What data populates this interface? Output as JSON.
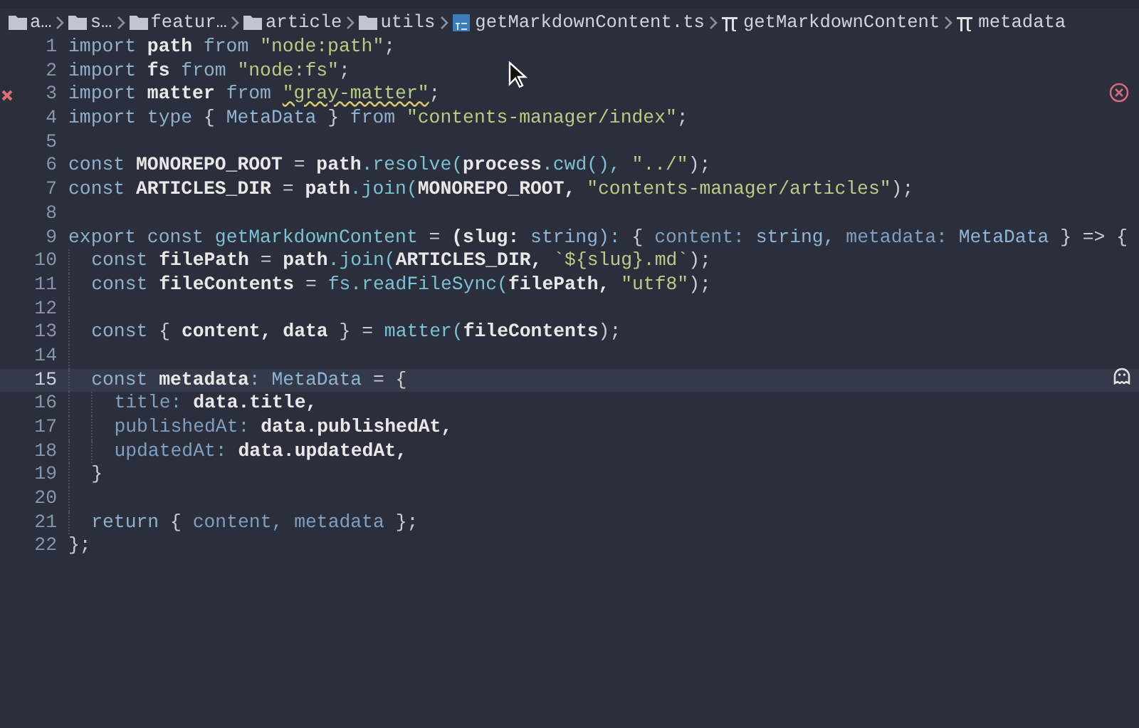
{
  "breadcrumb": [
    {
      "kind": "folder",
      "label": "a…"
    },
    {
      "kind": "folder",
      "label": "s…"
    },
    {
      "kind": "folder",
      "label": "featur…"
    },
    {
      "kind": "folder",
      "label": "article"
    },
    {
      "kind": "folder",
      "label": "utils"
    },
    {
      "kind": "file",
      "label": "getMarkdownContent.ts"
    },
    {
      "kind": "symbol",
      "label": "getMarkdownContent"
    },
    {
      "kind": "symbol",
      "label": "metadata"
    }
  ],
  "editor": {
    "lines": [
      {
        "number": "1",
        "error": false,
        "current": false,
        "tokens": [
          {
            "kind": "kw",
            "text": "import"
          },
          {
            "kind": "id",
            "text": "path"
          },
          {
            "kind": "kw",
            "text": "from"
          },
          {
            "kind": "str",
            "text": "\"node:path\""
          },
          {
            "kind": "p",
            "text": ";"
          }
        ]
      },
      {
        "number": "2",
        "error": false,
        "current": false,
        "tokens": [
          {
            "kind": "kw",
            "text": "import"
          },
          {
            "kind": "id",
            "text": "fs"
          },
          {
            "kind": "kw",
            "text": "from"
          },
          {
            "kind": "str",
            "text": "\"node:fs\""
          },
          {
            "kind": "p",
            "text": ";"
          }
        ]
      },
      {
        "number": "3",
        "error": true,
        "current": false,
        "tokens": [
          {
            "kind": "kw",
            "text": "import"
          },
          {
            "kind": "id",
            "text": "matter"
          },
          {
            "kind": "kw",
            "text": "from"
          },
          {
            "kind": "squiggle",
            "text": "\"gray-matter\""
          },
          {
            "kind": "p",
            "text": ";"
          }
        ]
      },
      {
        "number": "4",
        "error": false,
        "current": false,
        "tokens": [
          {
            "kind": "kw",
            "text": "import"
          },
          {
            "kind": "kw",
            "text": "type"
          },
          {
            "kind": "p",
            "text": "{"
          },
          {
            "kind": "type",
            "text": "MetaData"
          },
          {
            "kind": "p",
            "text": "}"
          },
          {
            "kind": "kw",
            "text": "from"
          },
          {
            "kind": "str",
            "text": "\"contents-manager/index\""
          },
          {
            "kind": "p",
            "text": ";"
          }
        ]
      },
      {
        "number": "5",
        "error": false,
        "current": false
      },
      {
        "number": "6",
        "error": false,
        "current": false,
        "tokens": [
          {
            "kind": "kw",
            "text": "const"
          },
          {
            "kind": "id",
            "text": "MONOREPO_ROOT"
          },
          {
            "kind": "p",
            "text": "="
          },
          {
            "kind": "id",
            "text": "path"
          },
          {
            "kind": "fn",
            "text": ".resolve("
          },
          {
            "kind": "id",
            "text": "process"
          },
          {
            "kind": "fn",
            "text": ".cwd(),"
          },
          {
            "kind": "str",
            "text": "\"../\""
          },
          {
            "kind": "p",
            "text": ");"
          }
        ]
      },
      {
        "number": "7",
        "error": false,
        "current": false,
        "tokens": [
          {
            "kind": "kw",
            "text": "const"
          },
          {
            "kind": "id",
            "text": "ARTICLES_DIR"
          },
          {
            "kind": "p",
            "text": "="
          },
          {
            "kind": "id",
            "text": "path"
          },
          {
            "kind": "fn",
            "text": ".join("
          },
          {
            "kind": "id",
            "text": "MONOREPO_ROOT,"
          },
          {
            "kind": "str",
            "text": "\"contents-manager/articles\""
          },
          {
            "kind": "p",
            "text": ");"
          }
        ]
      },
      {
        "number": "8",
        "error": false,
        "current": false
      },
      {
        "number": "9",
        "error": false,
        "current": false,
        "tokens": [
          {
            "kind": "kw",
            "text": "export"
          },
          {
            "kind": "kw",
            "text": "const"
          },
          {
            "kind": "fn",
            "text": "getMarkdownContent"
          },
          {
            "kind": "p",
            "text": "="
          },
          {
            "kind": "id",
            "text": "(slug:"
          },
          {
            "kind": "type",
            "text": "string):"
          },
          {
            "kind": "p",
            "text": "{"
          },
          {
            "kind": "prop",
            "text": "content:"
          },
          {
            "kind": "type",
            "text": "string,"
          },
          {
            "kind": "prop",
            "text": "metadata:"
          },
          {
            "kind": "type",
            "text": "MetaData"
          },
          {
            "kind": "p",
            "text": "} => {"
          }
        ],
        "children": [
          {
            "number": "10",
            "error": false,
            "current": false,
            "tokens": [
              {
                "kind": "kw",
                "text": "const"
              },
              {
                "kind": "id",
                "text": "filePath"
              },
              {
                "kind": "p",
                "text": "="
              },
              {
                "kind": "id",
                "text": "path"
              },
              {
                "kind": "fn",
                "text": ".join("
              },
              {
                "kind": "id",
                "text": "ARTICLES_DIR,"
              },
              {
                "kind": "str",
                "text": "`${slug}.md`"
              },
              {
                "kind": "p",
                "text": ");"
              }
            ]
          },
          {
            "number": "11",
            "error": false,
            "current": false,
            "tokens": [
              {
                "kind": "kw",
                "text": "const"
              },
              {
                "kind": "id",
                "text": "fileContents"
              },
              {
                "kind": "p",
                "text": "="
              },
              {
                "kind": "fn",
                "text": "fs.readFileSync("
              },
              {
                "kind": "id",
                "text": "filePath,"
              },
              {
                "kind": "str",
                "text": "\"utf8\""
              },
              {
                "kind": "p",
                "text": ");"
              }
            ]
          },
          {
            "number": "12",
            "error": false,
            "current": false
          },
          {
            "number": "13",
            "error": false,
            "current": false,
            "tokens": [
              {
                "kind": "kw",
                "text": "const"
              },
              {
                "kind": "p",
                "text": "{"
              },
              {
                "kind": "id",
                "text": "content,"
              },
              {
                "kind": "id",
                "text": "data"
              },
              {
                "kind": "p",
                "text": "} ="
              },
              {
                "kind": "fn",
                "text": "matter("
              },
              {
                "kind": "id",
                "text": "fileContents"
              },
              {
                "kind": "p",
                "text": ");"
              }
            ]
          },
          {
            "number": "14",
            "error": false,
            "current": false
          },
          {
            "number": "15",
            "error": false,
            "current": true,
            "tokens": [
              {
                "kind": "kw",
                "text": "const"
              },
              {
                "kind": "id",
                "text": "metadata"
              },
              {
                "kind": "type",
                "text": ": MetaData"
              },
              {
                "kind": "p",
                "text": "= {"
              }
            ],
            "children": [
              {
                "number": "16",
                "error": false,
                "current": false,
                "tokens": [
                  {
                    "kind": "prop",
                    "text": "title:"
                  },
                  {
                    "kind": "id",
                    "text": "data.title,"
                  }
                ]
              },
              {
                "number": "17",
                "error": false,
                "current": false,
                "tokens": [
                  {
                    "kind": "prop",
                    "text": "publishedAt:"
                  },
                  {
                    "kind": "id",
                    "text": "data.publishedAt,"
                  }
                ]
              },
              {
                "number": "18",
                "error": false,
                "current": false,
                "tokens": [
                  {
                    "kind": "prop",
                    "text": "updatedAt:"
                  },
                  {
                    "kind": "id",
                    "text": "data.updatedAt,"
                  }
                ]
              }
            ]
          },
          {
            "number": "19",
            "error": false,
            "current": false,
            "tokens": [
              {
                "kind": "p",
                "text": "}"
              }
            ]
          },
          {
            "number": "20",
            "error": false,
            "current": false
          },
          {
            "number": "21",
            "error": false,
            "current": false,
            "tokens": [
              {
                "kind": "kw",
                "text": "return"
              },
              {
                "kind": "p",
                "text": "{"
              },
              {
                "kind": "prop",
                "text": "content,"
              },
              {
                "kind": "prop",
                "text": "metadata"
              },
              {
                "kind": "p",
                "text": "};"
              }
            ]
          }
        ]
      },
      {
        "number": "22",
        "error": false,
        "current": false,
        "tokens": [
          {
            "kind": "p",
            "text": "};"
          }
        ]
      }
    ]
  }
}
